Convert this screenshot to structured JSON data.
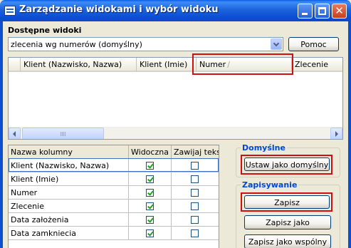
{
  "window": {
    "title": "Zarządzanie widokami i wybór widoku",
    "buttons": {
      "minimize": "minimize-icon",
      "maximize": "maximize-icon",
      "close": "close-icon"
    }
  },
  "available_views": {
    "label": "Dostępne widoki",
    "selected": "zlecenia wg numerów (domyślny)",
    "help_button": "Pomoc",
    "columns": [
      "Klient (Nazwisko, Nazwa)",
      "Klient (Imie)",
      "Numer",
      "Zlecenie"
    ],
    "sort_indicator": "∕",
    "scroll_grip": "|||"
  },
  "columns_table": {
    "headers": [
      "Nazwa kolumny",
      "Widoczna",
      "Zawijaj tekst"
    ],
    "rows": [
      {
        "name": "Klient (Nazwisko, Nazwa)",
        "visible": true,
        "wrap": false
      },
      {
        "name": "Klient (Imie)",
        "visible": true,
        "wrap": false
      },
      {
        "name": "Numer",
        "visible": true,
        "wrap": false
      },
      {
        "name": "Zlecenie",
        "visible": true,
        "wrap": false
      },
      {
        "name": "Data założenia",
        "visible": true,
        "wrap": false
      },
      {
        "name": "Data zamkniecia",
        "visible": true,
        "wrap": false
      }
    ]
  },
  "defaults_group": {
    "title": "Domyślne",
    "set_default_button": "Ustaw jako domyślny"
  },
  "saving_group": {
    "title": "Zapisywanie",
    "save_button": "Zapisz",
    "save_as_button": "Zapisz jako",
    "save_shared_button": "Zapisz jako wspólny"
  },
  "colors": {
    "title_bar": "#0a4fd3",
    "highlight": "#d01010",
    "group_title": "#0046d5",
    "window_bg": "#ece9d8"
  }
}
